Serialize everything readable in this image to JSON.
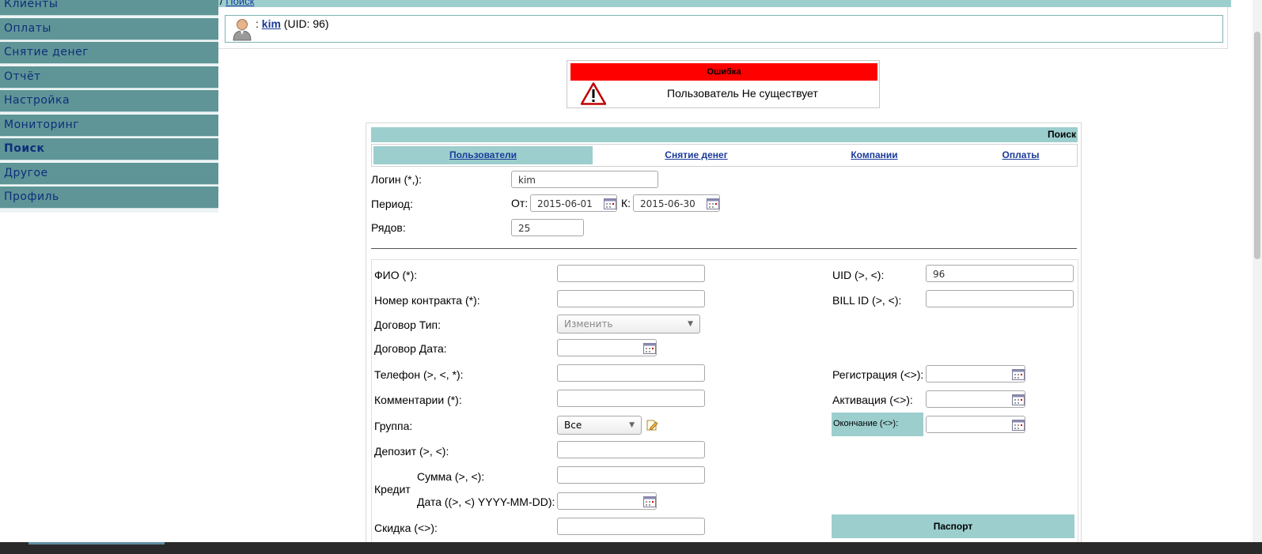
{
  "sidebar": {
    "items": [
      {
        "label": "Клиенты"
      },
      {
        "label": "Оплаты"
      },
      {
        "label": "Снятие денег"
      },
      {
        "label": "Отчёт"
      },
      {
        "label": "Настройка"
      },
      {
        "label": "Мониторинг"
      },
      {
        "label": "Поиск"
      },
      {
        "label": "Другое"
      },
      {
        "label": "Профиль"
      }
    ]
  },
  "breadcrumb": {
    "sep": "/",
    "link": "Поиск"
  },
  "user": {
    "sep": ":",
    "login": "kim",
    "uid": "(UID: 96)"
  },
  "error": {
    "title": "Ошибка",
    "message": "Пользователь Не существует"
  },
  "search": {
    "title": "Поиск",
    "tabs": [
      "Пользователи",
      "Снятие денег",
      "Компании",
      "Оплаты"
    ],
    "login_label": "Логин (*,):",
    "login_value": "kim",
    "period_label": "Период:",
    "from_label": "От:",
    "from_value": "2015-06-01",
    "to_label": "К:",
    "to_value": "2015-06-30",
    "rows_label": "Рядов:",
    "rows_value": "25"
  },
  "form": {
    "fio": "ФИО (*):",
    "contract": "Номер контракта (*):",
    "contract_type": "Договор Тип:",
    "contract_type_value": "Изменить",
    "contract_date": "Договор Дата:",
    "phone": "Телефон (>, <, *):",
    "comments": "Комментарии (*):",
    "group": "Группа:",
    "group_value": "Все",
    "deposit": "Депозит (>, <):",
    "credit": "Кредит",
    "credit_sum": "Сумма (>, <):",
    "credit_date": "Дата ((>, <) YYYY-MM-DD):",
    "discount": "Скидка (<>):",
    "uid": "UID (>, <):",
    "uid_value": "96",
    "bill_id": "BILL ID (>, <):",
    "registration": "Регистрация (<>):",
    "activation": "Активация (<>):",
    "expiry": "Окончание (<>):",
    "passport": "Паспорт"
  },
  "colors": {
    "teal": "#9ccece",
    "menu": "#5f9597",
    "error": "#ff0000",
    "link": "#1a3a9a"
  }
}
